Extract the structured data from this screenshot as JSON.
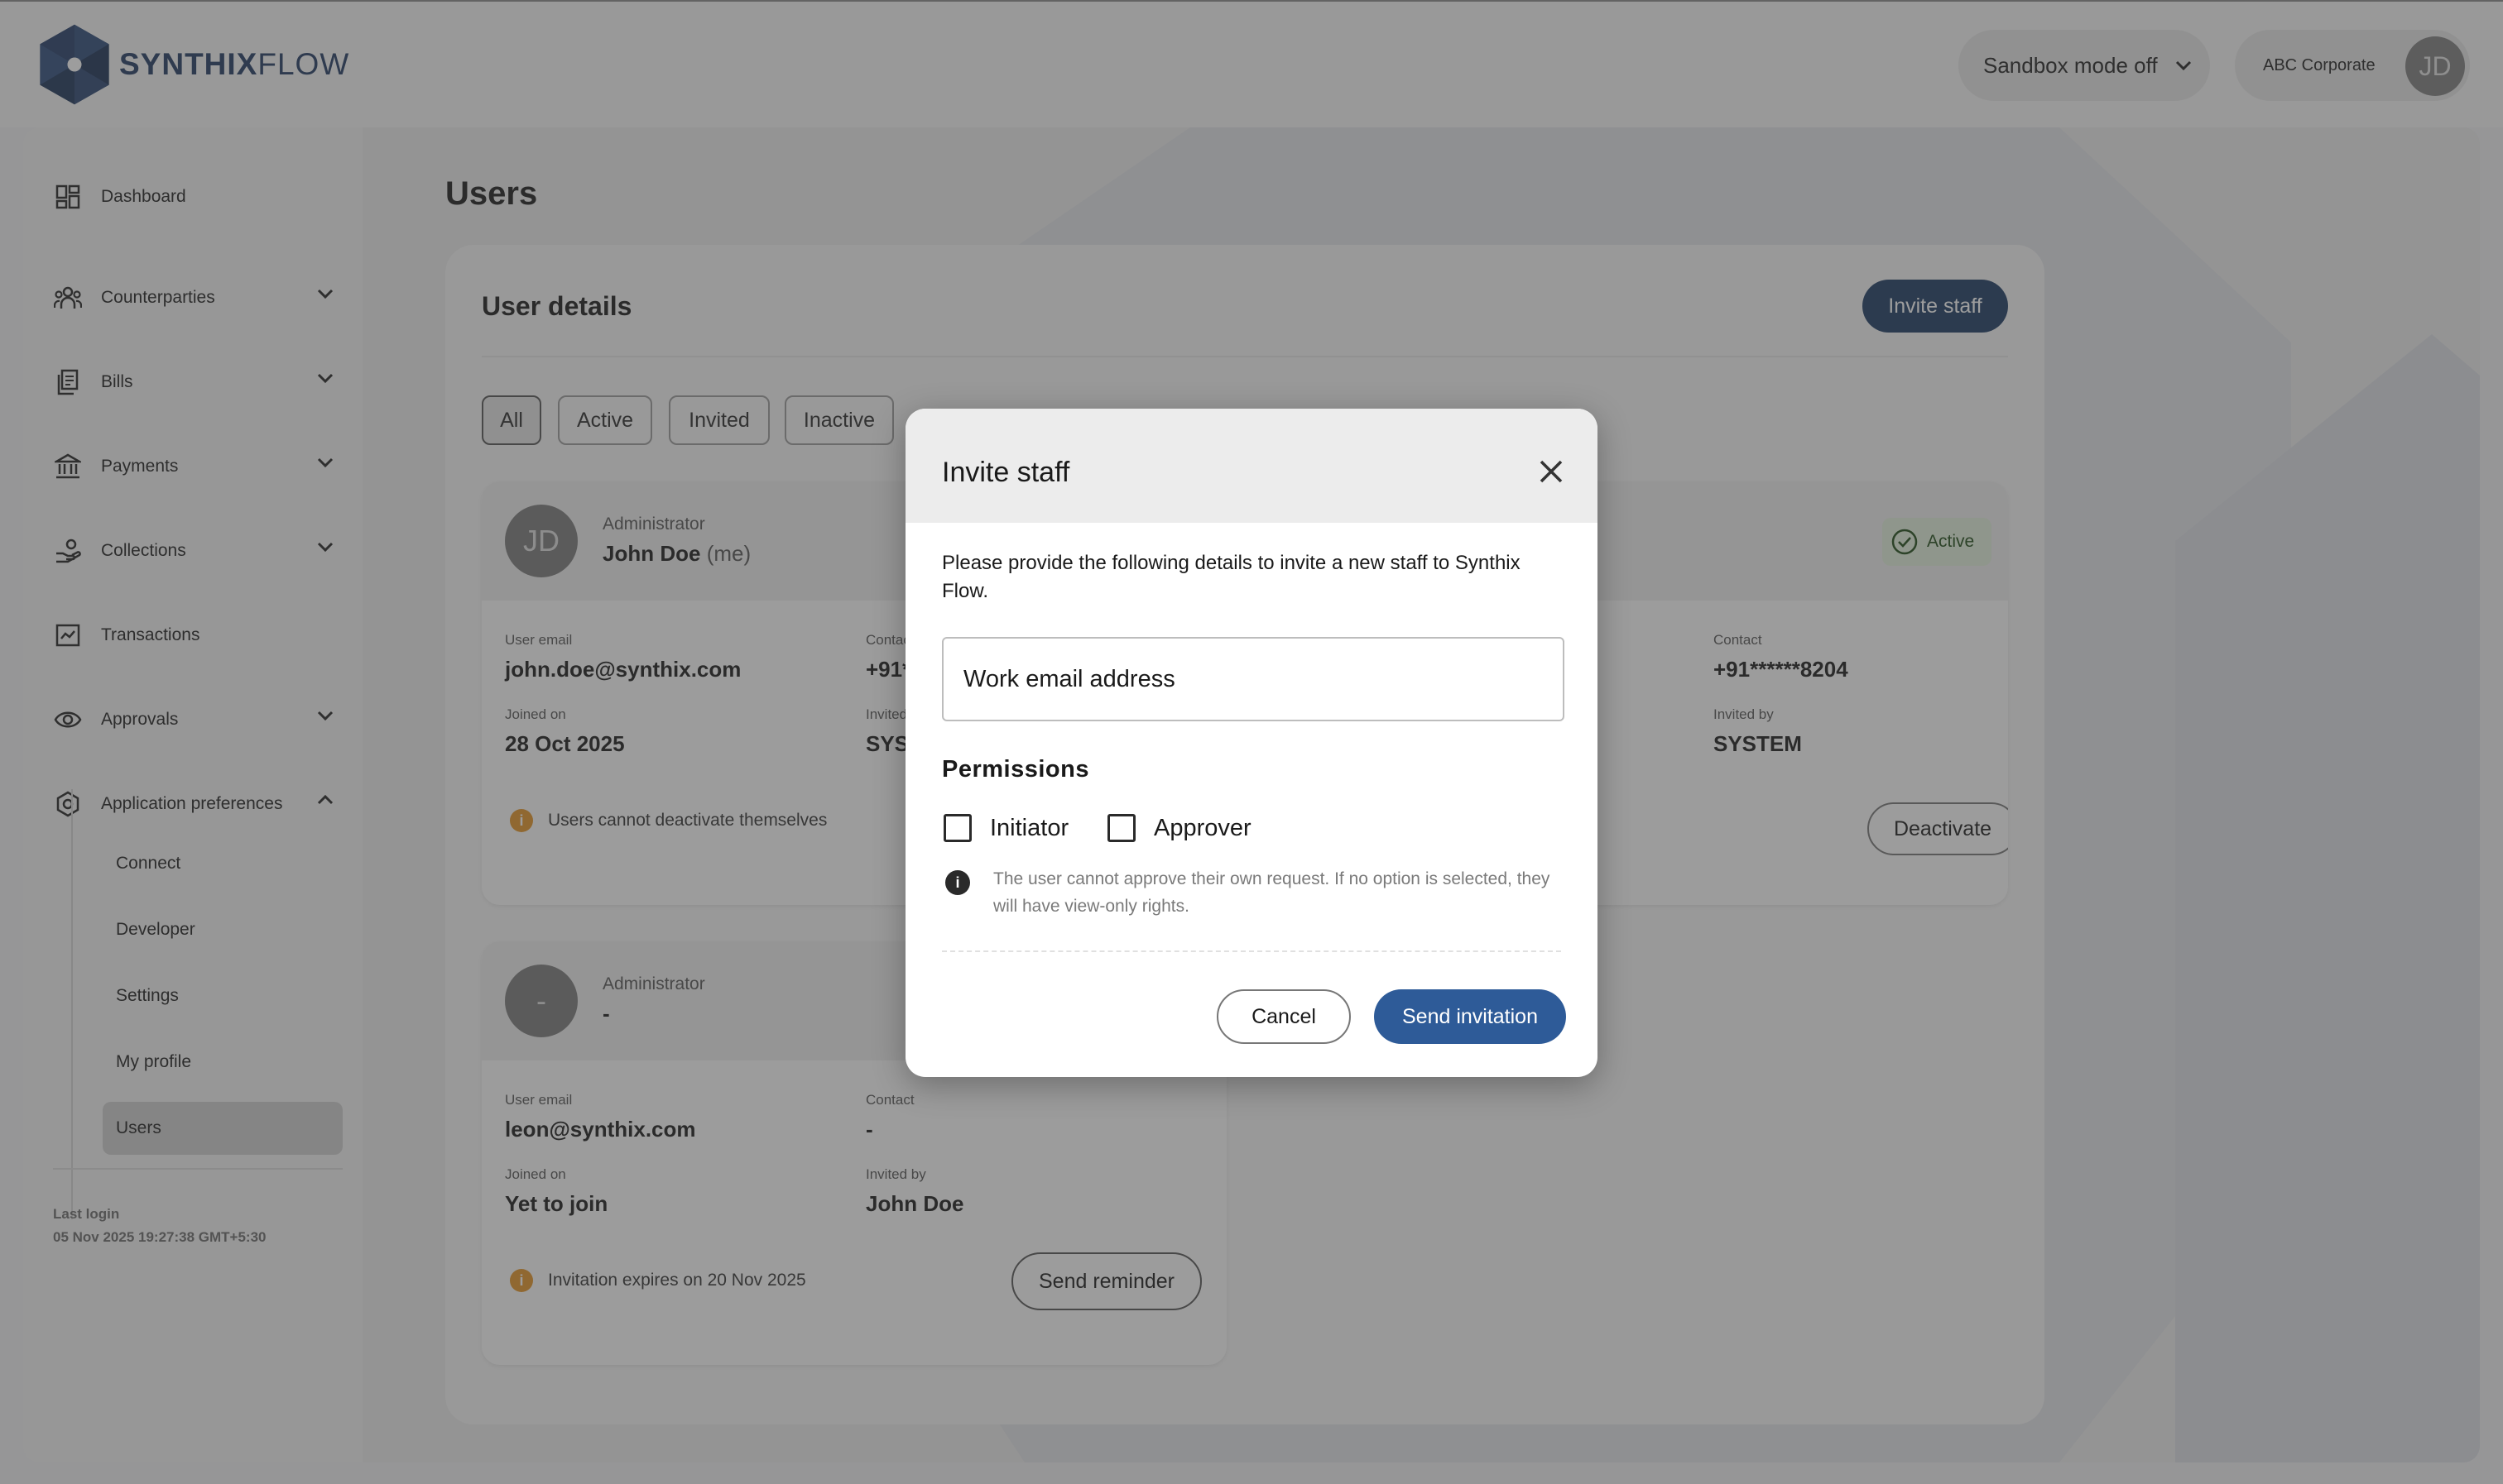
{
  "topbar": {
    "logo_strong": "SYNTHIX",
    "logo_light": "FLOW",
    "sandbox_label": "Sandbox mode off",
    "company": "ABC Corporate",
    "user_initials": "JD"
  },
  "sidebar": {
    "items": [
      {
        "label": "Dashboard",
        "icon": "dashboard-icon"
      },
      {
        "label": "Counterparties",
        "icon": "people-icon"
      },
      {
        "label": "Bills",
        "icon": "bills-icon"
      },
      {
        "label": "Payments",
        "icon": "bank-icon"
      },
      {
        "label": "Collections",
        "icon": "collections-icon"
      },
      {
        "label": "Transactions",
        "icon": "transactions-icon"
      },
      {
        "label": "Approvals",
        "icon": "eye-icon"
      },
      {
        "label": "Application preferences",
        "icon": "gear-icon"
      }
    ],
    "sub_items": [
      "Connect",
      "Developer",
      "Settings",
      "My profile",
      "Users"
    ],
    "active_sub": "Users",
    "last_login_label": "Last login",
    "last_login_value": "05 Nov 2025 19:27:38 GMT+5:30"
  },
  "main": {
    "page_title": "Users",
    "card_title": "User details",
    "invite_button": "Invite staff",
    "filters": [
      "All",
      "Active",
      "Invited",
      "Inactive"
    ],
    "selected_filter": "All",
    "users": [
      {
        "initials": "JD",
        "role": "Administrator",
        "name": "John Doe",
        "name_suffix": "(me)",
        "email_label": "User email",
        "email": "john.doe@synthix.com",
        "contact_label": "Contact",
        "contact": "+91***",
        "joined_label": "Joined on",
        "joined": "28 Oct 2025",
        "invited_label": "Invited by",
        "invited_by": "SYSTE",
        "note": "Users cannot deactivate themselves"
      },
      {
        "initials": "-",
        "role": "Administrator",
        "name": "-",
        "email_label": "User email",
        "email": "leon@synthix.com",
        "contact_label": "Contact",
        "contact": "-",
        "joined_label": "Joined on",
        "joined": "Yet to join",
        "invited_label": "Invited by",
        "invited_by": "John Doe",
        "note": "Invitation expires on 20 Nov 2025",
        "action": "Send reminder"
      }
    ],
    "right_card": {
      "status": "Active",
      "contact_label": "Contact",
      "contact": "+91******8204",
      "invited_label": "Invited by",
      "invited_by": "SYSTEM",
      "action": "Deactivate"
    }
  },
  "modal": {
    "title": "Invite staff",
    "description": "Please provide the following details to invite a new staff to Synthix Flow.",
    "email_placeholder": "Work email address",
    "permissions_label": "Permissions",
    "initiator_label": "Initiator",
    "approver_label": "Approver",
    "info_text": "The user cannot approve their own request. If no option is selected, they will have view-only rights.",
    "cancel_label": "Cancel",
    "send_label": "Send invitation"
  },
  "colors": {
    "brand": "#1d3b63",
    "primary_button": "#2e5b98",
    "warning": "#e49426",
    "active_badge": "#e3f0dc"
  }
}
